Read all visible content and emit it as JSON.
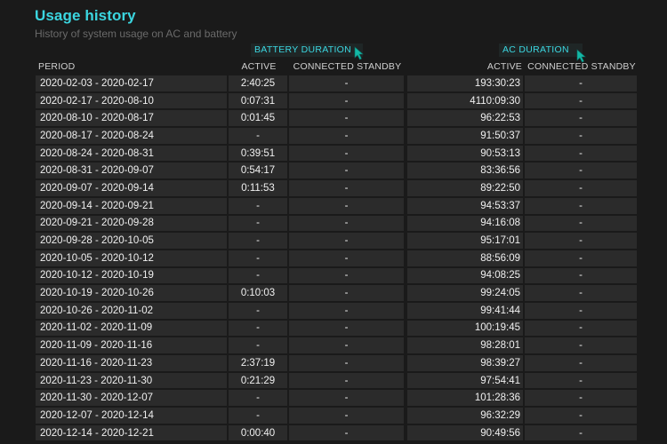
{
  "page": {
    "title": "Usage history",
    "subtitle": "History of system usage on AC and battery"
  },
  "groups": {
    "battery": "BATTERY DURATION",
    "ac": "AC DURATION"
  },
  "columns": {
    "period": "PERIOD",
    "battery_active": "ACTIVE",
    "battery_standby": "CONNECTED STANDBY",
    "ac_active": "ACTIVE",
    "ac_standby": "CONNECTED STANDBY"
  },
  "rows": [
    {
      "period": "2020-02-03 - 2020-02-17",
      "battery_active": "2:40:25",
      "battery_standby": "-",
      "ac_active": "193:30:23",
      "ac_standby": "-"
    },
    {
      "period": "2020-02-17 - 2020-08-10",
      "battery_active": "0:07:31",
      "battery_standby": "-",
      "ac_active": "4110:09:30",
      "ac_standby": "-"
    },
    {
      "period": "2020-08-10 - 2020-08-17",
      "battery_active": "0:01:45",
      "battery_standby": "-",
      "ac_active": "96:22:53",
      "ac_standby": "-"
    },
    {
      "period": "2020-08-17 - 2020-08-24",
      "battery_active": "-",
      "battery_standby": "-",
      "ac_active": "91:50:37",
      "ac_standby": "-"
    },
    {
      "period": "2020-08-24 - 2020-08-31",
      "battery_active": "0:39:51",
      "battery_standby": "-",
      "ac_active": "90:53:13",
      "ac_standby": "-"
    },
    {
      "period": "2020-08-31 - 2020-09-07",
      "battery_active": "0:54:17",
      "battery_standby": "-",
      "ac_active": "83:36:56",
      "ac_standby": "-"
    },
    {
      "period": "2020-09-07 - 2020-09-14",
      "battery_active": "0:11:53",
      "battery_standby": "-",
      "ac_active": "89:22:50",
      "ac_standby": "-"
    },
    {
      "period": "2020-09-14 - 2020-09-21",
      "battery_active": "-",
      "battery_standby": "-",
      "ac_active": "94:53:37",
      "ac_standby": "-"
    },
    {
      "period": "2020-09-21 - 2020-09-28",
      "battery_active": "-",
      "battery_standby": "-",
      "ac_active": "94:16:08",
      "ac_standby": "-"
    },
    {
      "period": "2020-09-28 - 2020-10-05",
      "battery_active": "-",
      "battery_standby": "-",
      "ac_active": "95:17:01",
      "ac_standby": "-"
    },
    {
      "period": "2020-10-05 - 2020-10-12",
      "battery_active": "-",
      "battery_standby": "-",
      "ac_active": "88:56:09",
      "ac_standby": "-"
    },
    {
      "period": "2020-10-12 - 2020-10-19",
      "battery_active": "-",
      "battery_standby": "-",
      "ac_active": "94:08:25",
      "ac_standby": "-"
    },
    {
      "period": "2020-10-19 - 2020-10-26",
      "battery_active": "0:10:03",
      "battery_standby": "-",
      "ac_active": "99:24:05",
      "ac_standby": "-"
    },
    {
      "period": "2020-10-26 - 2020-11-02",
      "battery_active": "-",
      "battery_standby": "-",
      "ac_active": "99:41:44",
      "ac_standby": "-"
    },
    {
      "period": "2020-11-02 - 2020-11-09",
      "battery_active": "-",
      "battery_standby": "-",
      "ac_active": "100:19:45",
      "ac_standby": "-"
    },
    {
      "period": "2020-11-09 - 2020-11-16",
      "battery_active": "-",
      "battery_standby": "-",
      "ac_active": "98:28:01",
      "ac_standby": "-"
    },
    {
      "period": "2020-11-16 - 2020-11-23",
      "battery_active": "2:37:19",
      "battery_standby": "-",
      "ac_active": "98:39:27",
      "ac_standby": "-"
    },
    {
      "period": "2020-11-23 - 2020-11-30",
      "battery_active": "0:21:29",
      "battery_standby": "-",
      "ac_active": "97:54:41",
      "ac_standby": "-"
    },
    {
      "period": "2020-11-30 - 2020-12-07",
      "battery_active": "-",
      "battery_standby": "-",
      "ac_active": "101:28:36",
      "ac_standby": "-"
    },
    {
      "period": "2020-12-07 - 2020-12-14",
      "battery_active": "-",
      "battery_standby": "-",
      "ac_active": "96:32:29",
      "ac_standby": "-"
    },
    {
      "period": "2020-12-14 - 2020-12-21",
      "battery_active": "0:00:40",
      "battery_standby": "-",
      "ac_active": "90:49:56",
      "ac_standby": "-"
    }
  ],
  "colors": {
    "accent": "#3bd6e0",
    "background": "#1a1a1a",
    "row_background": "#2b2b2b",
    "text": "#f0f0f0",
    "subtitle": "#6a6a6a",
    "cursor": "#14b8a6"
  },
  "icons": {
    "cursor": "mouse-pointer-icon"
  }
}
